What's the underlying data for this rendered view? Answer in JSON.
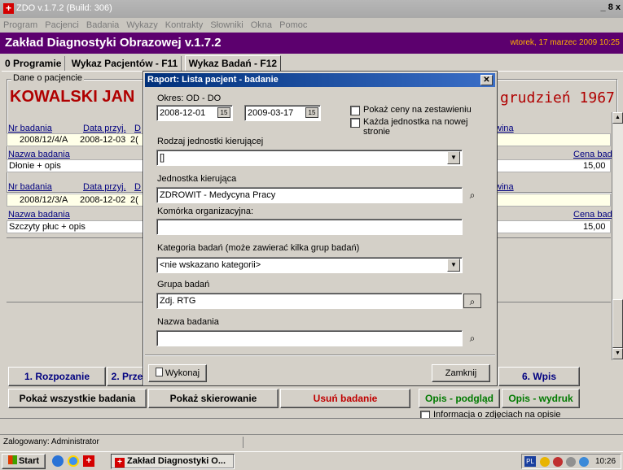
{
  "window": {
    "title": "ZDO v.1.7.2 (Build: 306)",
    "controls": "_ 8 x"
  },
  "menu": [
    "Program",
    "Pacjenci",
    "Badania",
    "Wykazy",
    "Kontrakty",
    "Słowniki",
    "Okna",
    "Pomoc"
  ],
  "app_header": {
    "title": "Zakład Diagnostyki Obrazowej v.1.7.2",
    "datetime": "wtorek, 17 marzec 2009 10:25"
  },
  "tabs": [
    "0 Programie",
    "Wykaz Pacjentów - F11",
    "Wykaz Badań - F12"
  ],
  "patient": {
    "group_label": "Dane o pacjencie",
    "name": "KOWALSKI JAN",
    "birth_text": "grudzień 1967"
  },
  "exam_columns": {
    "nr": "Nr badania",
    "data": "Data przyj.",
    "d": "D",
    "wina": "wina",
    "nazwa": "Nazwa badania",
    "cena": "Cena bad."
  },
  "exams": [
    {
      "nr": "2008/12/4/A",
      "data": "2008-12-03",
      "d": "2(",
      "nazwa": "Dłonie + opis",
      "cena": "15,00"
    },
    {
      "nr": "2008/12/3/A",
      "data": "2008-12-02",
      "d": "2(",
      "nazwa": "Szczyty płuc + opis",
      "cena": "15,00"
    }
  ],
  "bottom_buttons": {
    "rozpoznanie": "1. Rozpozanie",
    "prze": "2. Prze",
    "wpis": "6. Wpis",
    "pokaz_wszystkie": "Pokaż wszystkie badania",
    "pokaz_skierowanie": "Pokaż skierowanie",
    "usun": "Usuń badanie",
    "opis_podglad": "Opis - podgląd",
    "opis_wydruk": "Opis - wydruk",
    "informacja": "Informacja o zdjęciach na opisie"
  },
  "dialog": {
    "title": "Raport: Lista pacjent - badanie",
    "okres_label": "Okres: OD - DO",
    "date_from": "2008-12-01",
    "date_to": "2009-03-17",
    "cal_icon": "15",
    "pokaz_ceny": "Pokaż ceny na zestawieniu",
    "kazda_jednostka": "Każda jednostka na nowej stronie",
    "rodzaj_label": "Rodzaj jednostki kierującej",
    "rodzaj_value": "[]",
    "jednostka_label": "Jednostka kierująca",
    "jednostka_value": "ZDROWIT - Medycyna Pracy",
    "komorka_label": "Komórka organizacyjna:",
    "komorka_value": "",
    "kategoria_label": "Kategoria badań (może zawierać kilka grup badań)",
    "kategoria_value": "<nie wskazano kategorii>",
    "grupa_label": "Grupa badań",
    "grupa_value": "Zdj. RTG",
    "nazwa_label": "Nazwa badania",
    "nazwa_value": "",
    "wykonaj": "Wykonaj",
    "zamknij": "Zamknij"
  },
  "status": {
    "user": "Zalogowany: Administrator"
  },
  "taskbar": {
    "start": "Start",
    "task": "Zakład Diagnostyki O...",
    "lang": "PL",
    "time": "10:26"
  },
  "colors": {
    "header_bg": "#5c006e",
    "date_color": "#ffb200",
    "patient_red": "#b00000",
    "dialog_title": "#00307a"
  }
}
